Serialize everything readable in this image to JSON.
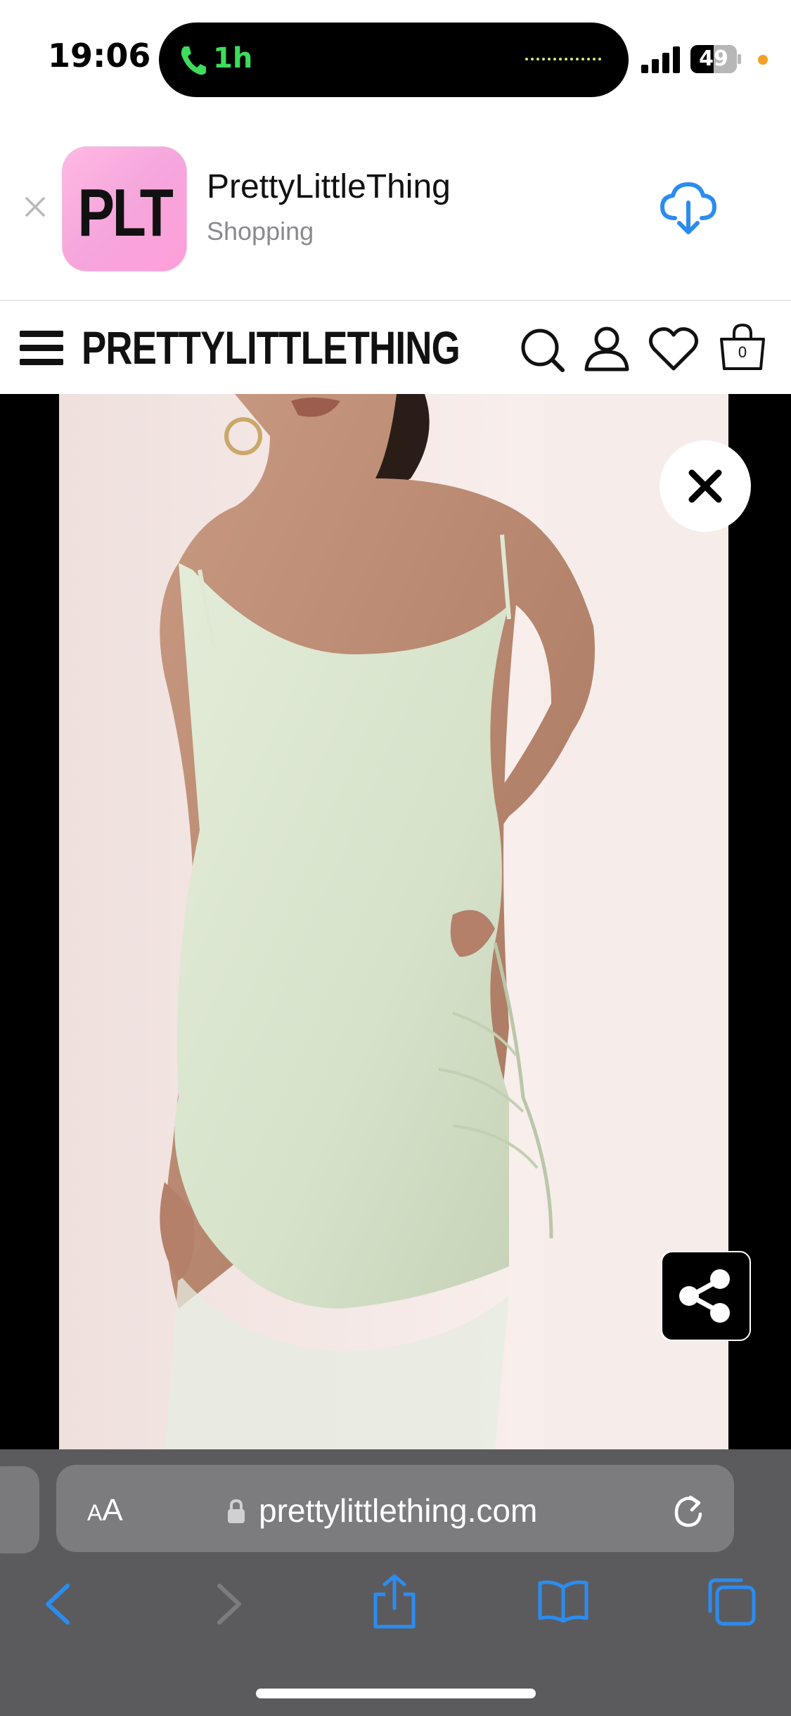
{
  "status_bar": {
    "time": "19:06",
    "call_duration": "1h",
    "battery_level": "49",
    "icons": [
      "phone-icon",
      "waveform",
      "signal-icon",
      "battery-icon"
    ]
  },
  "smart_banner": {
    "app_icon_text": "PLT",
    "app_name": "PrettyLittleThing",
    "category": "Shopping",
    "icons": [
      "close-icon",
      "cloud-download-icon"
    ]
  },
  "site_header": {
    "logo": "PRETTYLITTLETHING",
    "bag_count": "0",
    "icons": [
      "hamburger-menu-icon",
      "search-icon",
      "account-icon",
      "heart-icon",
      "shopping-bag-icon"
    ]
  },
  "product_viewer": {
    "icons": [
      "close-icon",
      "share-icon"
    ]
  },
  "browser": {
    "aa_label_big": "A",
    "aa_label_small": "A",
    "url": "prettylittlething.com",
    "icons": [
      "lock-icon",
      "reload-icon",
      "back-icon",
      "forward-icon",
      "share-icon",
      "bookmarks-icon",
      "tabs-icon"
    ]
  },
  "colors": {
    "accent_blue": "#2b8cf0",
    "call_green": "#3ddc5c",
    "toolbar_gray": "#5b5b5d",
    "dress_sage": "#dfe8d3"
  }
}
